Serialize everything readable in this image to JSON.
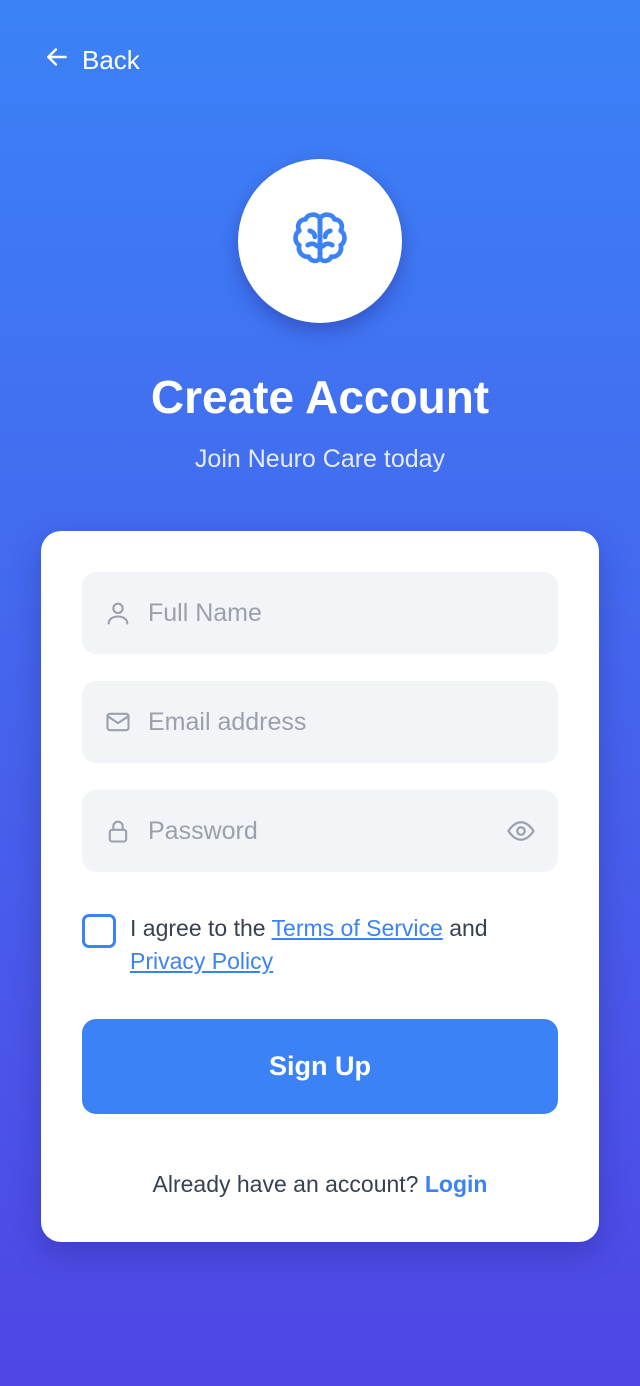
{
  "header": {
    "back_label": "Back"
  },
  "hero": {
    "title": "Create Account",
    "subtitle": "Join Neuro Care today"
  },
  "form": {
    "full_name_placeholder": "Full Name",
    "full_name_value": "",
    "email_placeholder": "Email address",
    "email_value": "",
    "password_placeholder": "Password",
    "password_value": "",
    "agree_prefix": "I agree to the",
    "terms_link": "Terms of Service",
    "agree_and": "and",
    "privacy_link": "Privacy Policy",
    "agree_checked": false,
    "signup_label": "Sign Up",
    "login_prompt": "Already have an account?",
    "login_link": "Login"
  },
  "icons": {
    "back": "arrow-left-icon",
    "logo": "brain-icon",
    "full_name": "user-icon",
    "email": "mail-icon",
    "password": "lock-icon",
    "toggle_password": "eye-icon"
  },
  "colors": {
    "gradient_top": "#3b82f6",
    "gradient_bottom": "#4f46e5",
    "accent": "#3b82f6",
    "field_bg": "#f2f4f7",
    "placeholder": "#9aa1ad"
  }
}
